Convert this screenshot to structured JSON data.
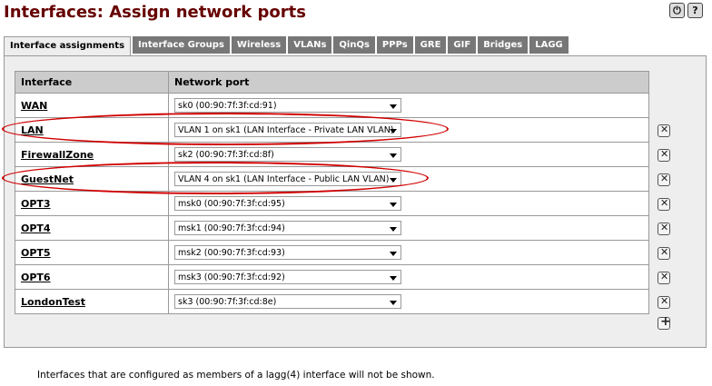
{
  "page": {
    "title": "Interfaces: Assign network ports"
  },
  "header_icons": [
    {
      "name": "logout-icon",
      "glyph": "⏻"
    },
    {
      "name": "help-icon",
      "glyph": "?"
    }
  ],
  "tabs": [
    {
      "label": "Interface assignments",
      "active": true
    },
    {
      "label": "Interface Groups"
    },
    {
      "label": "Wireless"
    },
    {
      "label": "VLANs"
    },
    {
      "label": "QinQs"
    },
    {
      "label": "PPPs"
    },
    {
      "label": "GRE"
    },
    {
      "label": "GIF"
    },
    {
      "label": "Bridges"
    },
    {
      "label": "LAGG"
    }
  ],
  "table": {
    "headers": {
      "interface": "Interface",
      "port": "Network port"
    },
    "rows": [
      {
        "name": "WAN",
        "port": "sk0 (00:90:7f:3f:cd:91)",
        "deletable": false
      },
      {
        "name": "LAN",
        "port": "VLAN 1 on sk1 (LAN Interface - Private LAN VLAN)",
        "deletable": true
      },
      {
        "name": "FirewallZone",
        "port": "sk2 (00:90:7f:3f:cd:8f)",
        "deletable": true
      },
      {
        "name": "GuestNet",
        "port": "VLAN 4 on sk1 (LAN Interface - Public LAN VLAN)",
        "deletable": true
      },
      {
        "name": "OPT3",
        "port": "msk0 (00:90:7f:3f:cd:95)",
        "deletable": true
      },
      {
        "name": "OPT4",
        "port": "msk1 (00:90:7f:3f:cd:94)",
        "deletable": true
      },
      {
        "name": "OPT5",
        "port": "msk2 (00:90:7f:3f:cd:93)",
        "deletable": true
      },
      {
        "name": "OPT6",
        "port": "msk3 (00:90:7f:3f:cd:92)",
        "deletable": true
      },
      {
        "name": "LondonTest",
        "port": "sk3 (00:90:7f:3f:cd:8e)",
        "deletable": true
      }
    ]
  },
  "note": "Interfaces that are configured as members of a lagg(4) interface will not be shown.",
  "colors": {
    "title": "#660000",
    "tab_bg": "#777777",
    "annotation": "#d00000"
  }
}
